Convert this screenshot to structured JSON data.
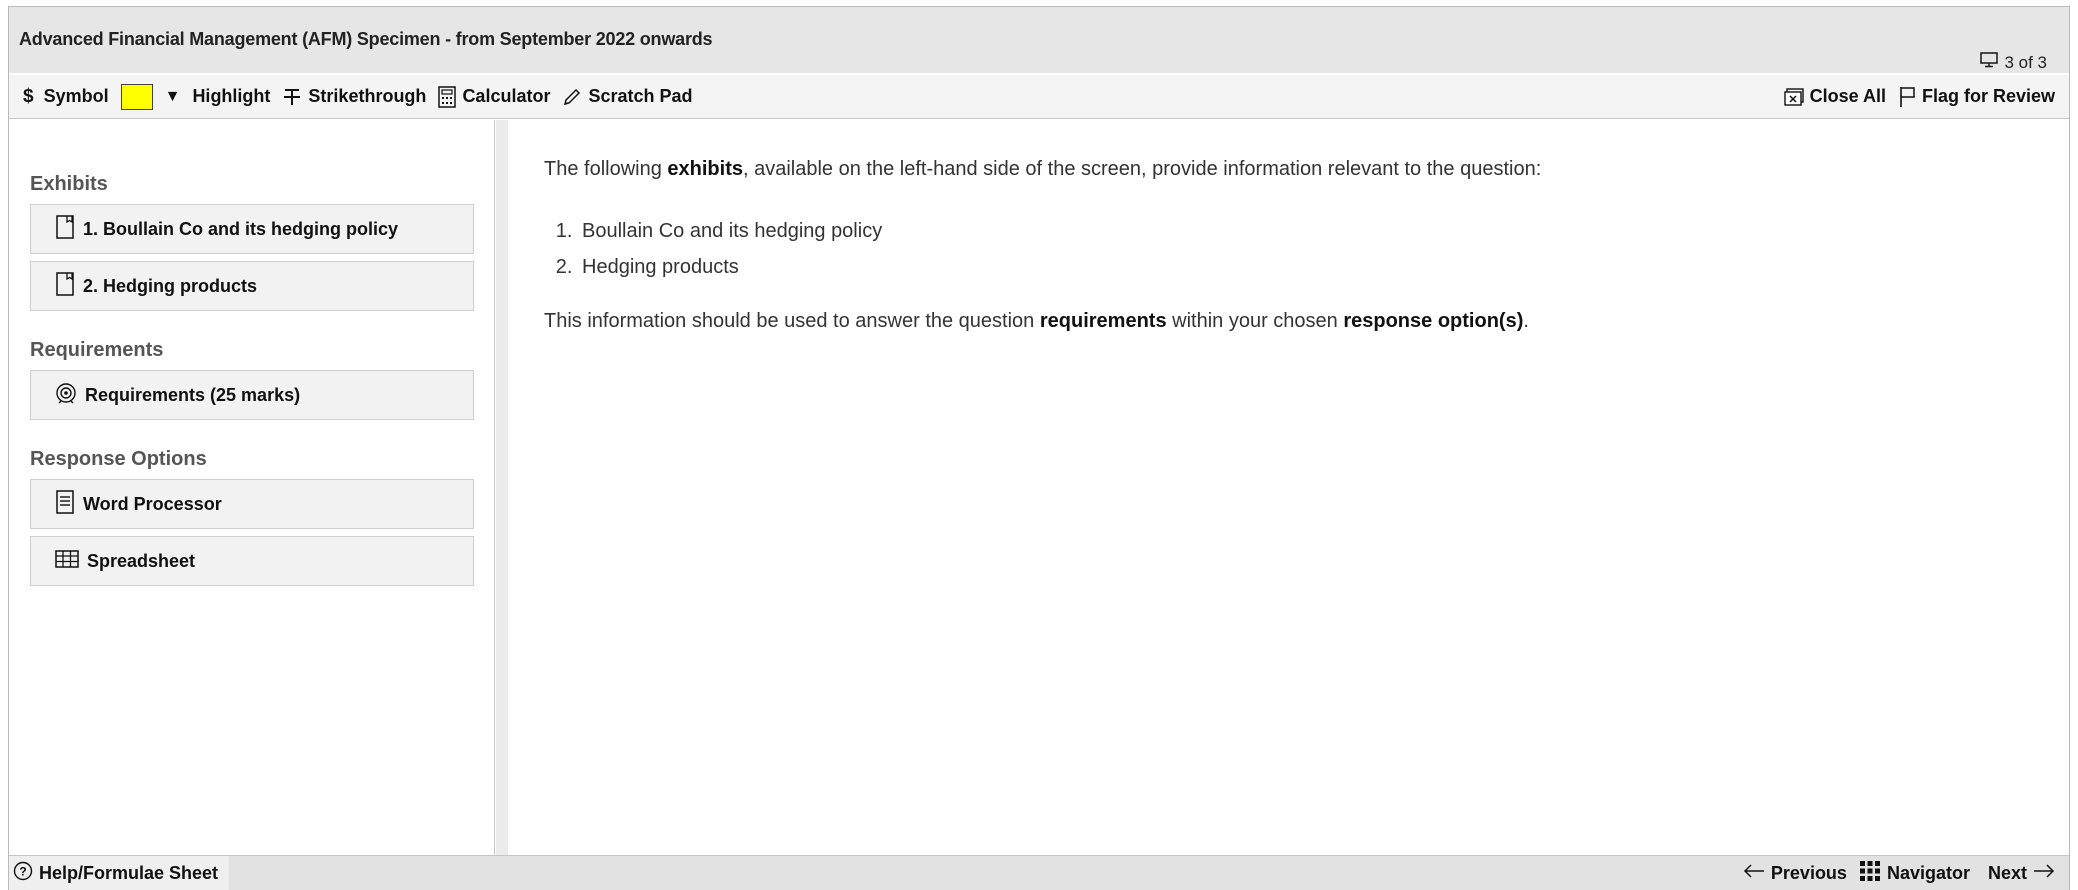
{
  "header": {
    "title": "Advanced Financial Management (AFM) Specimen - from September 2022 onwards",
    "question_counter": "3 of 3"
  },
  "toolbar": {
    "symbol_label": "Symbol",
    "highlight_color": "#ffff00",
    "highlight_label": "Highlight",
    "strikethrough_label": "Strikethrough",
    "calculator_label": "Calculator",
    "scratch_pad_label": "Scratch Pad",
    "close_all_label": "Close All",
    "flag_label": "Flag for Review"
  },
  "sidebar": {
    "exhibits_heading": "Exhibits",
    "exhibits": [
      {
        "label": "1. Boullain Co and its hedging policy",
        "icon": "document-icon"
      },
      {
        "label": "2. Hedging products",
        "icon": "document-icon"
      }
    ],
    "requirements_heading": "Requirements",
    "requirements": [
      {
        "label": "Requirements (25 marks)",
        "icon": "target-icon"
      }
    ],
    "response_heading": "Response Options",
    "responses": [
      {
        "label": "Word Processor",
        "icon": "word-processor-icon"
      },
      {
        "label": "Spreadsheet",
        "icon": "spreadsheet-icon"
      }
    ]
  },
  "main": {
    "intro_before": "The following ",
    "intro_bold": "exhibits",
    "intro_after": ", available on the left-hand side of the screen, provide information relevant to the question:",
    "list": [
      "Boullain Co and its hedging policy",
      "Hedging products"
    ],
    "outro_before": "This information should be used to answer the question ",
    "outro_bold1": "requirements",
    "outro_mid": " within your chosen ",
    "outro_bold2": "response option(s)",
    "outro_after": "."
  },
  "footer": {
    "help_label": "Help/Formulae Sheet",
    "previous_label": "Previous",
    "navigator_label": "Navigator",
    "next_label": "Next"
  }
}
